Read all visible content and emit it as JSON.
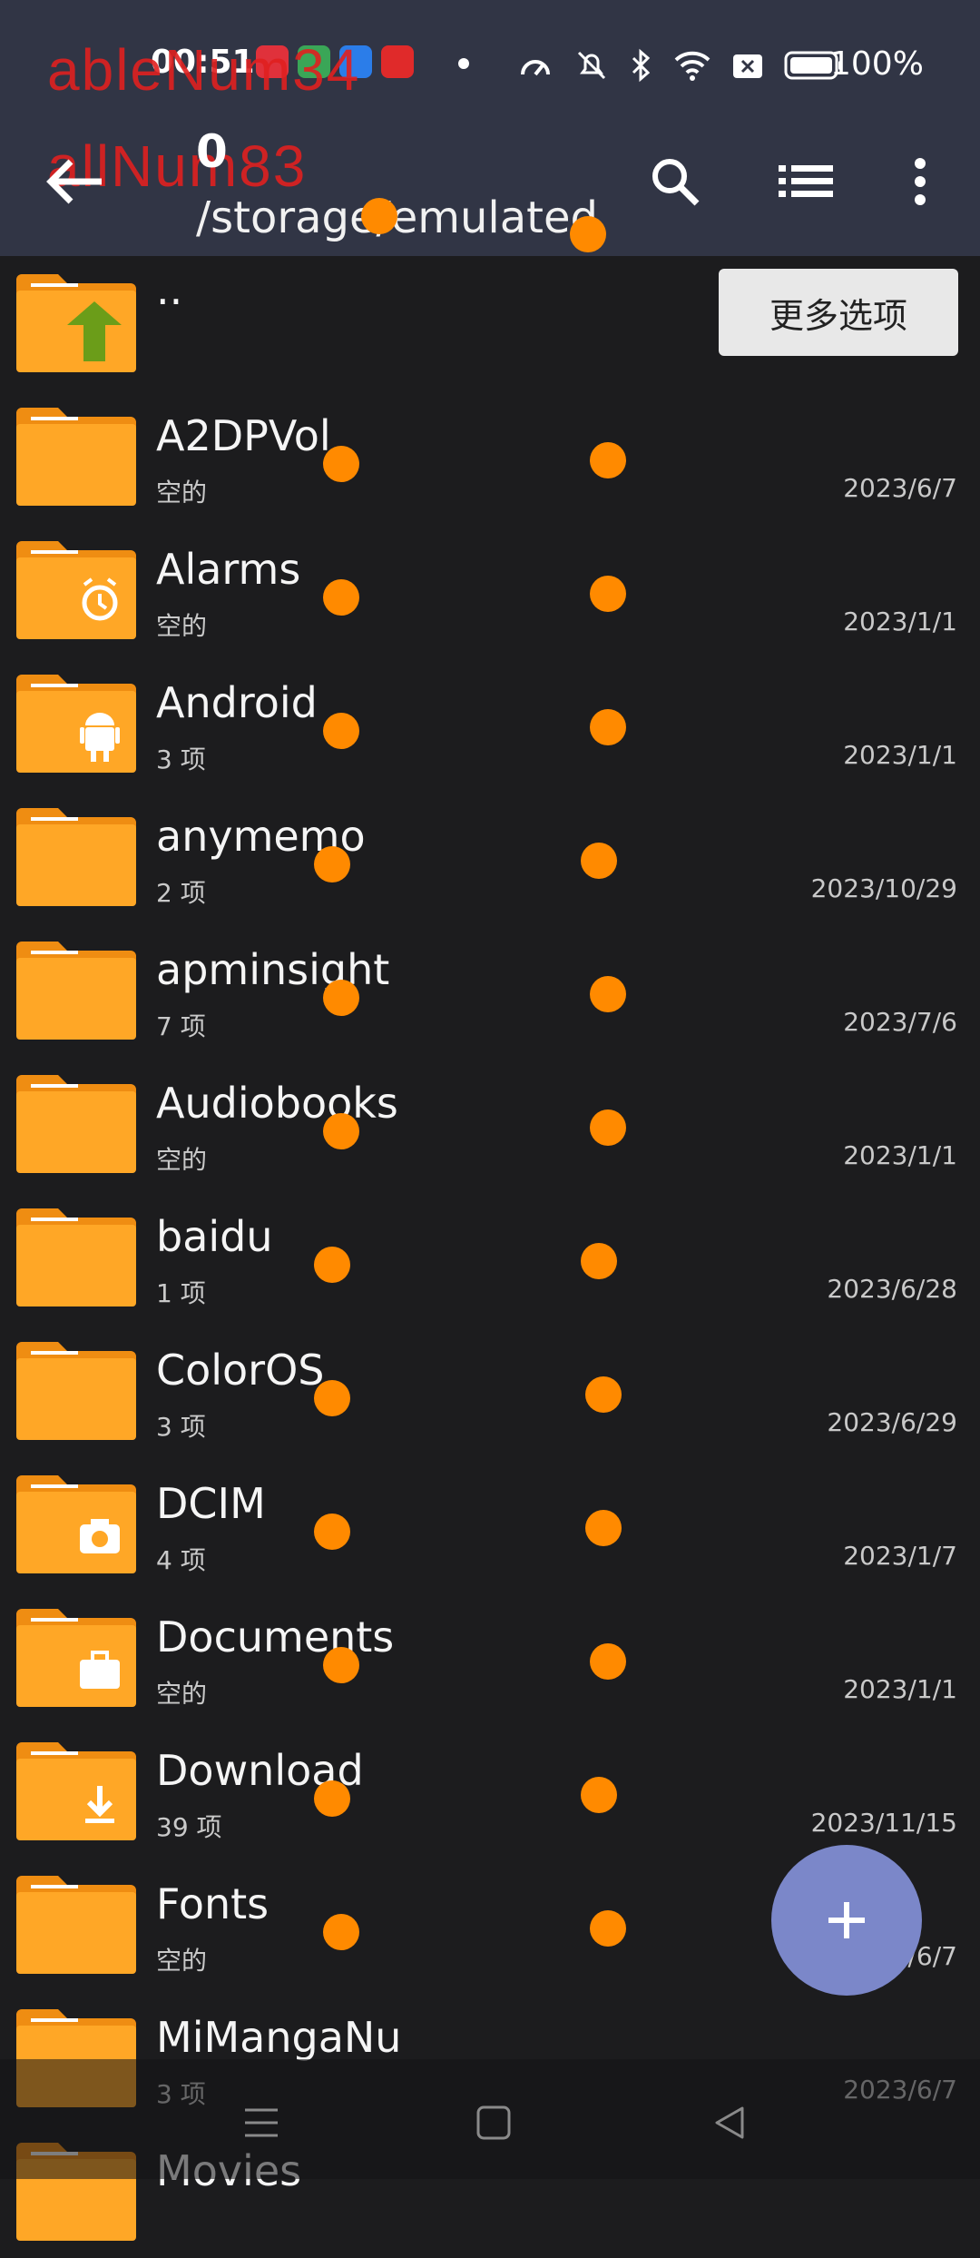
{
  "status": {
    "time": "00:51",
    "battery": "100%"
  },
  "watermark": {
    "line1": "ableNum34",
    "line2": "allNum83"
  },
  "toolbar": {
    "title": "0",
    "path": "/storage/emulated"
  },
  "more_options": "更多选项",
  "parent_dir": "..",
  "files": [
    {
      "name": "A2DPVol",
      "meta": "空的",
      "date": "2023/6/7",
      "icon": "plain"
    },
    {
      "name": "Alarms",
      "meta": "空的",
      "date": "2023/1/1",
      "icon": "alarm"
    },
    {
      "name": "Android",
      "meta": "3 项",
      "date": "2023/1/1",
      "icon": "android"
    },
    {
      "name": "anymemo",
      "meta": "2 项",
      "date": "2023/10/29",
      "icon": "plain"
    },
    {
      "name": "apminsight",
      "meta": "7 项",
      "date": "2023/7/6",
      "icon": "plain"
    },
    {
      "name": "Audiobooks",
      "meta": "空的",
      "date": "2023/1/1",
      "icon": "plain"
    },
    {
      "name": "baidu",
      "meta": "1 项",
      "date": "2023/6/28",
      "icon": "plain"
    },
    {
      "name": "ColorOS",
      "meta": "3 项",
      "date": "2023/6/29",
      "icon": "plain"
    },
    {
      "name": "DCIM",
      "meta": "4 项",
      "date": "2023/1/7",
      "icon": "camera"
    },
    {
      "name": "Documents",
      "meta": "空的",
      "date": "2023/1/1",
      "icon": "briefcase"
    },
    {
      "name": "Download",
      "meta": "39 项",
      "date": "2023/11/15",
      "icon": "download"
    },
    {
      "name": "Fonts",
      "meta": "空的",
      "date": "2023/6/7",
      "icon": "plain"
    },
    {
      "name": "MiMangaNu",
      "meta": "3 项",
      "date": "2023/6/7",
      "icon": "plain"
    },
    {
      "name": "Movies",
      "meta": "",
      "date": "",
      "icon": "plain"
    }
  ],
  "colors": {
    "header": "#313545",
    "background": "#1c1c1e",
    "folder": "#ffa726",
    "fab": "#7b87c9",
    "marker": "#ff8a00"
  }
}
